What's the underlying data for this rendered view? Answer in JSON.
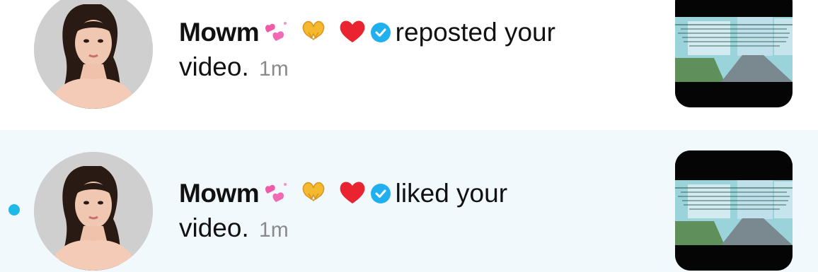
{
  "colors": {
    "unread_dot": "#20b8e8",
    "verified_badge": "#20b0f0",
    "highlight_row_bg": "#f1f9fd",
    "timestamp": "#8a8a8a"
  },
  "notifications": [
    {
      "username": "Mowm",
      "emojis": [
        "pink-hearts-emoji",
        "heart-hands-emoji",
        "red-heart-emoji"
      ],
      "verified_icon": "verified-check-icon",
      "action_text": "reposted your",
      "object_text": "video.",
      "timestamp": "1m",
      "unread": false
    },
    {
      "username": "Mowm",
      "emojis": [
        "pink-hearts-emoji",
        "heart-hands-emoji",
        "red-heart-emoji"
      ],
      "verified_icon": "verified-check-icon",
      "action_text": "liked your",
      "object_text": "video.",
      "timestamp": "1m",
      "unread": true
    }
  ]
}
